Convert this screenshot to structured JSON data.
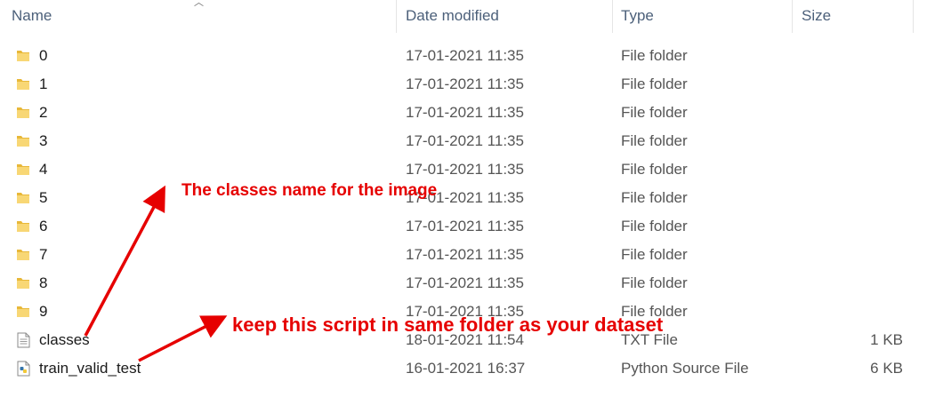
{
  "columns": {
    "name": "Name",
    "date_modified": "Date modified",
    "type": "Type",
    "size": "Size"
  },
  "files": [
    {
      "name": "0",
      "date": "17-01-2021 11:35",
      "type": "File folder",
      "size": "",
      "icon": "folder-icon"
    },
    {
      "name": "1",
      "date": "17-01-2021 11:35",
      "type": "File folder",
      "size": "",
      "icon": "folder-icon"
    },
    {
      "name": "2",
      "date": "17-01-2021 11:35",
      "type": "File folder",
      "size": "",
      "icon": "folder-icon"
    },
    {
      "name": "3",
      "date": "17-01-2021 11:35",
      "type": "File folder",
      "size": "",
      "icon": "folder-icon"
    },
    {
      "name": "4",
      "date": "17-01-2021 11:35",
      "type": "File folder",
      "size": "",
      "icon": "folder-icon"
    },
    {
      "name": "5",
      "date": "17-01-2021 11:35",
      "type": "File folder",
      "size": "",
      "icon": "folder-icon"
    },
    {
      "name": "6",
      "date": "17-01-2021 11:35",
      "type": "File folder",
      "size": "",
      "icon": "folder-icon"
    },
    {
      "name": "7",
      "date": "17-01-2021 11:35",
      "type": "File folder",
      "size": "",
      "icon": "folder-icon"
    },
    {
      "name": "8",
      "date": "17-01-2021 11:35",
      "type": "File folder",
      "size": "",
      "icon": "folder-icon"
    },
    {
      "name": "9",
      "date": "17-01-2021 11:35",
      "type": "File folder",
      "size": "",
      "icon": "folder-icon"
    },
    {
      "name": "classes",
      "date": "18-01-2021 11:54",
      "type": "TXT File",
      "size": "1 KB",
      "icon": "text-file-icon"
    },
    {
      "name": "train_valid_test",
      "date": "16-01-2021 16:37",
      "type": "Python Source File",
      "size": "6 KB",
      "icon": "python-file-icon"
    }
  ],
  "annotations": {
    "classes_note": "The classes name for the image",
    "script_note": "keep this script in same folder as your dataset"
  },
  "colors": {
    "annotation": "#e60000",
    "folder": "#f8d775",
    "header_text": "#4c607a"
  }
}
